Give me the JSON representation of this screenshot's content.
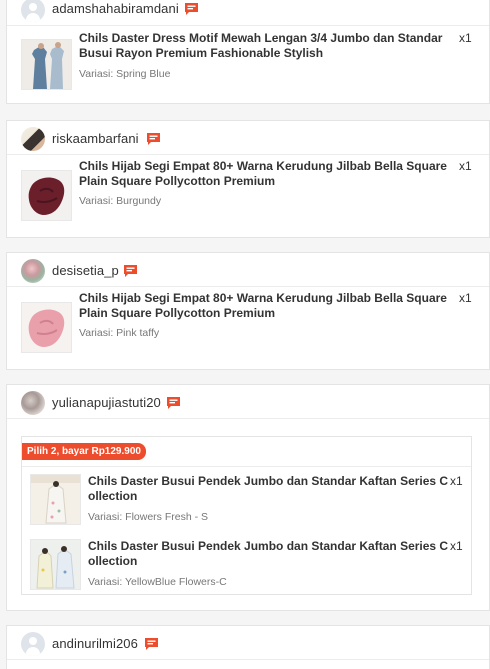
{
  "orders": [
    {
      "username": "adamshahabiramdani",
      "items": [
        {
          "name": "Chils Daster Dress Motif Mewah Lengan 3/4 Jumbo dan Standar Busui Rayon Premium Fashionable Stylish",
          "variant": "Variasi: Spring Blue",
          "qty": "x1"
        }
      ]
    },
    {
      "username": "riskaambarfani",
      "items": [
        {
          "name": "Chils Hijab Segi Empat 80+ Warna Kerudung Jilbab Bella Square Plain Square Pollycotton Premium",
          "variant": "Variasi: Burgundy",
          "qty": "x1"
        }
      ]
    },
    {
      "username": "desisetia_p",
      "items": [
        {
          "name": "Chils Hijab Segi Empat 80+ Warna Kerudung Jilbab Bella Square Plain Square Pollycotton Premium",
          "variant": "Variasi: Pink taffy",
          "qty": "x1"
        }
      ]
    },
    {
      "username": "yulianapujiastuti20",
      "bundle_label": "Pilih 2, bayar Rp129.900",
      "items": [
        {
          "name": "Chils Daster Busui Pendek Jumbo dan Standar Kaftan Series Collection",
          "variant": "Variasi: Flowers Fresh - S",
          "qty": "x1"
        },
        {
          "name": "Chils Daster Busui Pendek Jumbo dan Standar Kaftan Series Collection",
          "variant": "Variasi: YellowBlue Flowers-C",
          "qty": "x1"
        }
      ]
    },
    {
      "username": "andinurilmi206",
      "items": []
    }
  ],
  "colors": {
    "accent": "#ee4d2d",
    "burgundy": "#6b1f2b",
    "pink_taffy": "#e9a0ab"
  },
  "icons": {
    "chat": "chat-icon",
    "avatar_default": "default-avatar-icon"
  }
}
